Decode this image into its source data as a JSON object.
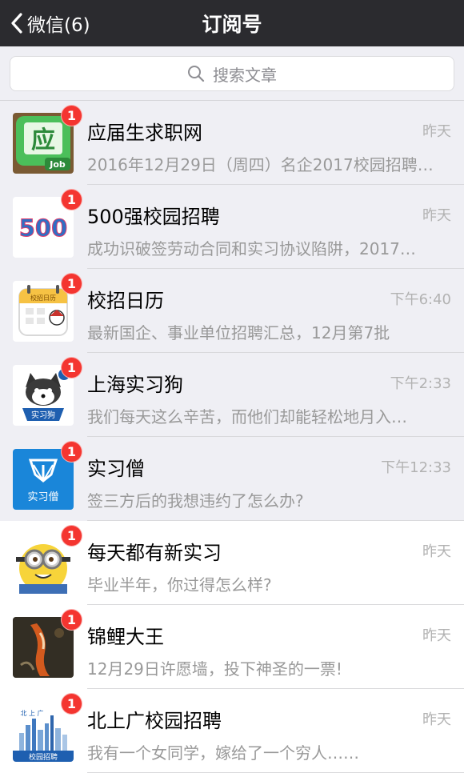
{
  "nav": {
    "back_label": "微信(6)",
    "title": "订阅号"
  },
  "search": {
    "placeholder": "搜索文章"
  },
  "items": [
    {
      "name": "应届生求职网",
      "time": "昨天",
      "preview": "2016年12月29日（周四）名企2017校园招聘…",
      "badge": "1",
      "avatar_text": "应",
      "avatar_sub": "Job"
    },
    {
      "name": "500强校园招聘",
      "time": "昨天",
      "preview": "成功识破签劳动合同和实习协议陷阱，2017…",
      "badge": "1",
      "avatar_text": "500"
    },
    {
      "name": "校招日历",
      "time": "下午6:40",
      "preview": "最新国企、事业单位招聘汇总，12月第7批",
      "badge": "1",
      "avatar_text": "校招日历"
    },
    {
      "name": "上海实习狗",
      "time": "下午2:33",
      "preview": "我们每天这么辛苦，而他们却能轻松地月入…",
      "badge": "1",
      "avatar_text": "实习狗"
    },
    {
      "name": "实习僧",
      "time": "下午12:33",
      "preview": "签三方后的我想违约了怎么办?",
      "badge": "1",
      "avatar_text": "实习僧"
    },
    {
      "name": "每天都有新实习",
      "time": "昨天",
      "preview": "毕业半年，你过得怎么样?",
      "badge": "1"
    },
    {
      "name": "锦鲤大王",
      "time": "昨天",
      "preview": "12月29日许愿墙，投下神圣的一票!",
      "badge": "1"
    },
    {
      "name": "北上广校园招聘",
      "time": "昨天",
      "preview": "我有一个女同学，嫁给了一个穷人……",
      "badge": "1",
      "avatar_text": "校园招聘",
      "avatar_sub": "北 上 广"
    }
  ]
}
